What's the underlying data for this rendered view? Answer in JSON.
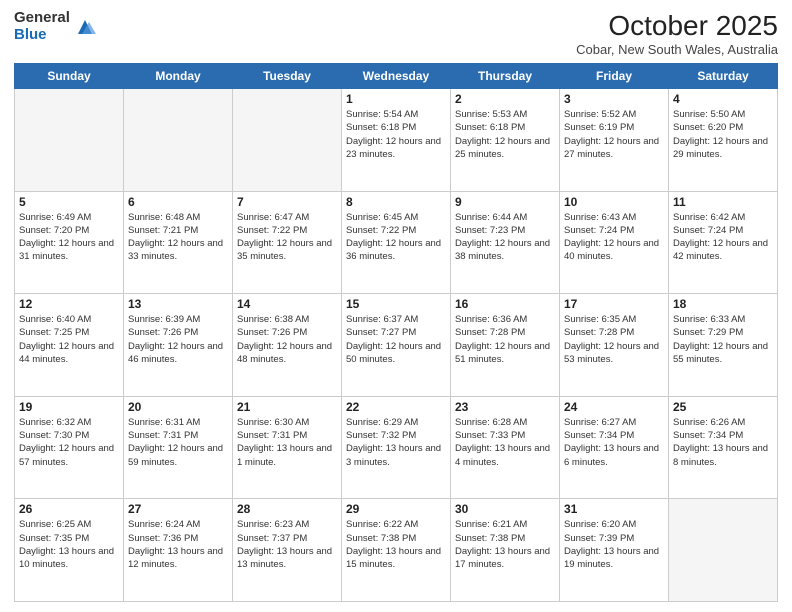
{
  "logo": {
    "general": "General",
    "blue": "Blue"
  },
  "header": {
    "month": "October 2025",
    "location": "Cobar, New South Wales, Australia"
  },
  "days_of_week": [
    "Sunday",
    "Monday",
    "Tuesday",
    "Wednesday",
    "Thursday",
    "Friday",
    "Saturday"
  ],
  "weeks": [
    [
      {
        "day": "",
        "content": ""
      },
      {
        "day": "",
        "content": ""
      },
      {
        "day": "",
        "content": ""
      },
      {
        "day": "1",
        "content": "Sunrise: 5:54 AM\nSunset: 6:18 PM\nDaylight: 12 hours\nand 23 minutes."
      },
      {
        "day": "2",
        "content": "Sunrise: 5:53 AM\nSunset: 6:18 PM\nDaylight: 12 hours\nand 25 minutes."
      },
      {
        "day": "3",
        "content": "Sunrise: 5:52 AM\nSunset: 6:19 PM\nDaylight: 12 hours\nand 27 minutes."
      },
      {
        "day": "4",
        "content": "Sunrise: 5:50 AM\nSunset: 6:20 PM\nDaylight: 12 hours\nand 29 minutes."
      }
    ],
    [
      {
        "day": "5",
        "content": "Sunrise: 6:49 AM\nSunset: 7:20 PM\nDaylight: 12 hours\nand 31 minutes."
      },
      {
        "day": "6",
        "content": "Sunrise: 6:48 AM\nSunset: 7:21 PM\nDaylight: 12 hours\nand 33 minutes."
      },
      {
        "day": "7",
        "content": "Sunrise: 6:47 AM\nSunset: 7:22 PM\nDaylight: 12 hours\nand 35 minutes."
      },
      {
        "day": "8",
        "content": "Sunrise: 6:45 AM\nSunset: 7:22 PM\nDaylight: 12 hours\nand 36 minutes."
      },
      {
        "day": "9",
        "content": "Sunrise: 6:44 AM\nSunset: 7:23 PM\nDaylight: 12 hours\nand 38 minutes."
      },
      {
        "day": "10",
        "content": "Sunrise: 6:43 AM\nSunset: 7:24 PM\nDaylight: 12 hours\nand 40 minutes."
      },
      {
        "day": "11",
        "content": "Sunrise: 6:42 AM\nSunset: 7:24 PM\nDaylight: 12 hours\nand 42 minutes."
      }
    ],
    [
      {
        "day": "12",
        "content": "Sunrise: 6:40 AM\nSunset: 7:25 PM\nDaylight: 12 hours\nand 44 minutes."
      },
      {
        "day": "13",
        "content": "Sunrise: 6:39 AM\nSunset: 7:26 PM\nDaylight: 12 hours\nand 46 minutes."
      },
      {
        "day": "14",
        "content": "Sunrise: 6:38 AM\nSunset: 7:26 PM\nDaylight: 12 hours\nand 48 minutes."
      },
      {
        "day": "15",
        "content": "Sunrise: 6:37 AM\nSunset: 7:27 PM\nDaylight: 12 hours\nand 50 minutes."
      },
      {
        "day": "16",
        "content": "Sunrise: 6:36 AM\nSunset: 7:28 PM\nDaylight: 12 hours\nand 51 minutes."
      },
      {
        "day": "17",
        "content": "Sunrise: 6:35 AM\nSunset: 7:28 PM\nDaylight: 12 hours\nand 53 minutes."
      },
      {
        "day": "18",
        "content": "Sunrise: 6:33 AM\nSunset: 7:29 PM\nDaylight: 12 hours\nand 55 minutes."
      }
    ],
    [
      {
        "day": "19",
        "content": "Sunrise: 6:32 AM\nSunset: 7:30 PM\nDaylight: 12 hours\nand 57 minutes."
      },
      {
        "day": "20",
        "content": "Sunrise: 6:31 AM\nSunset: 7:31 PM\nDaylight: 12 hours\nand 59 minutes."
      },
      {
        "day": "21",
        "content": "Sunrise: 6:30 AM\nSunset: 7:31 PM\nDaylight: 13 hours\nand 1 minute."
      },
      {
        "day": "22",
        "content": "Sunrise: 6:29 AM\nSunset: 7:32 PM\nDaylight: 13 hours\nand 3 minutes."
      },
      {
        "day": "23",
        "content": "Sunrise: 6:28 AM\nSunset: 7:33 PM\nDaylight: 13 hours\nand 4 minutes."
      },
      {
        "day": "24",
        "content": "Sunrise: 6:27 AM\nSunset: 7:34 PM\nDaylight: 13 hours\nand 6 minutes."
      },
      {
        "day": "25",
        "content": "Sunrise: 6:26 AM\nSunset: 7:34 PM\nDaylight: 13 hours\nand 8 minutes."
      }
    ],
    [
      {
        "day": "26",
        "content": "Sunrise: 6:25 AM\nSunset: 7:35 PM\nDaylight: 13 hours\nand 10 minutes."
      },
      {
        "day": "27",
        "content": "Sunrise: 6:24 AM\nSunset: 7:36 PM\nDaylight: 13 hours\nand 12 minutes."
      },
      {
        "day": "28",
        "content": "Sunrise: 6:23 AM\nSunset: 7:37 PM\nDaylight: 13 hours\nand 13 minutes."
      },
      {
        "day": "29",
        "content": "Sunrise: 6:22 AM\nSunset: 7:38 PM\nDaylight: 13 hours\nand 15 minutes."
      },
      {
        "day": "30",
        "content": "Sunrise: 6:21 AM\nSunset: 7:38 PM\nDaylight: 13 hours\nand 17 minutes."
      },
      {
        "day": "31",
        "content": "Sunrise: 6:20 AM\nSunset: 7:39 PM\nDaylight: 13 hours\nand 19 minutes."
      },
      {
        "day": "",
        "content": ""
      }
    ]
  ]
}
